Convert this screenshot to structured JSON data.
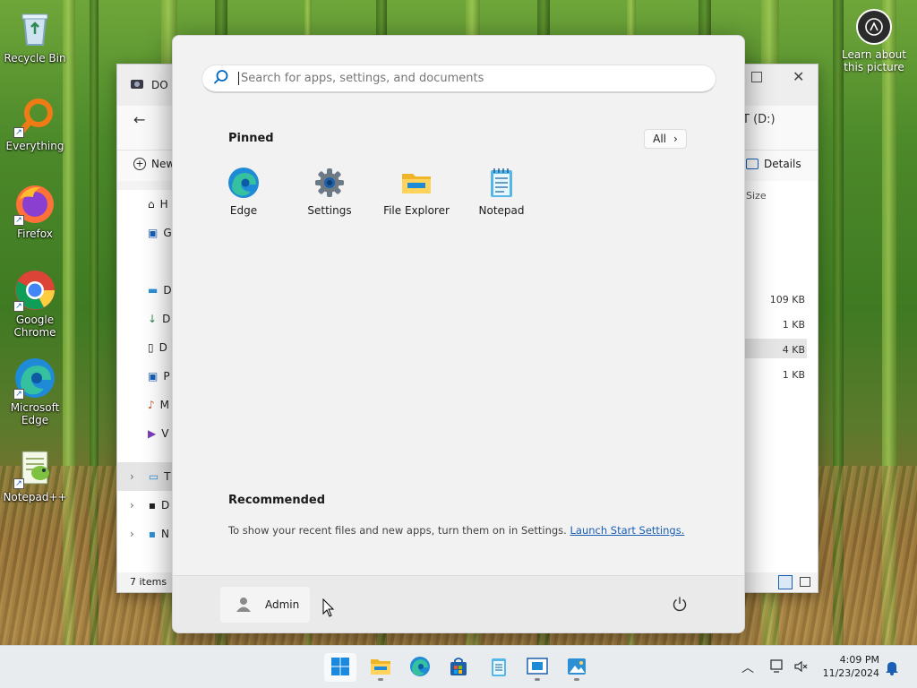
{
  "desktop": {
    "icons": [
      {
        "label": "Recycle Bin"
      },
      {
        "label": "Everything"
      },
      {
        "label": "Firefox"
      },
      {
        "label": "Google Chrome"
      },
      {
        "label": "Microsoft Edge"
      },
      {
        "label": "Notepad++"
      }
    ],
    "learn_label": "Learn about this picture"
  },
  "explorer": {
    "tab_title": "DO",
    "toolbar": {
      "new_label": "New",
      "details_label": "Details"
    },
    "drive_label": "T (D:)",
    "column_size": "Size",
    "nav_items": [
      "H",
      "G",
      "D",
      "D",
      "D",
      "P",
      "M",
      "V",
      "T",
      "D",
      "N"
    ],
    "sizes": [
      "109 KB",
      "1 KB",
      "4 KB",
      "1 KB"
    ],
    "status": "7 items"
  },
  "start": {
    "search": {
      "placeholder": "Search for apps, settings, and documents",
      "value": ""
    },
    "pinned_title": "Pinned",
    "all_label": "All",
    "pinned": [
      {
        "label": "Edge"
      },
      {
        "label": "Settings"
      },
      {
        "label": "File Explorer"
      },
      {
        "label": "Notepad"
      }
    ],
    "recommended_title": "Recommended",
    "recommended_text": "To show your recent files and new apps, turn them on in Settings.",
    "recommended_link": "Launch Start Settings.",
    "user_name": "Admin"
  },
  "taskbar": {
    "time": "4:09 PM",
    "date": "11/23/2024"
  },
  "colors": {
    "accent": "#0067c0",
    "link": "#1a5fb4",
    "start_bg": "#f2f2f2"
  }
}
